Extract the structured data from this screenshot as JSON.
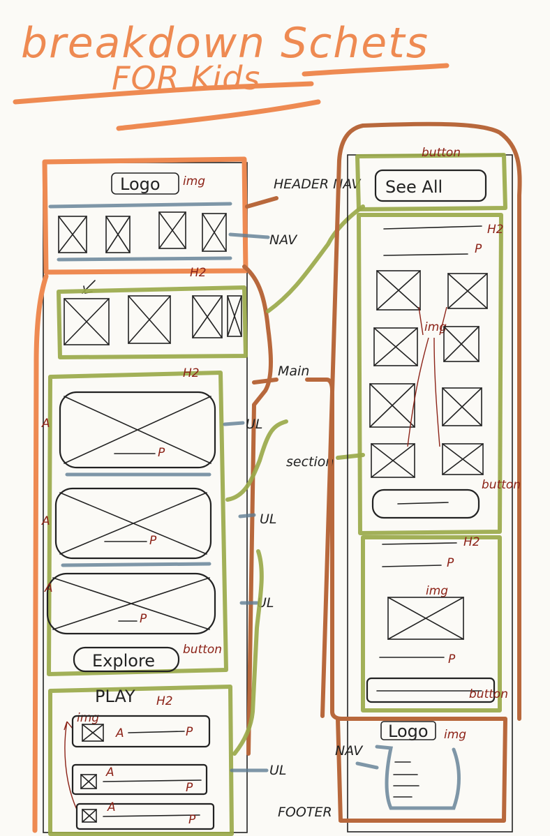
{
  "title": "breakdown Schets",
  "subtitle": "FOR Kids",
  "annotations": {
    "img": "img",
    "h2": "H2",
    "a": "A",
    "p": "P",
    "button": "button",
    "header_nav": "HEADER NAV",
    "nav": "NAV",
    "main": "Main",
    "ul": "UL",
    "section": "section",
    "footer": "FOOTER"
  },
  "buttons": {
    "logo": "Logo",
    "see_all": "See All",
    "explore": "Explore",
    "play": "PLAY"
  },
  "colors": {
    "header": "#ee8a52",
    "main": "#b8683c",
    "section": "#9aa94a",
    "list": "#5f7d93",
    "tags": "#8c2318"
  }
}
